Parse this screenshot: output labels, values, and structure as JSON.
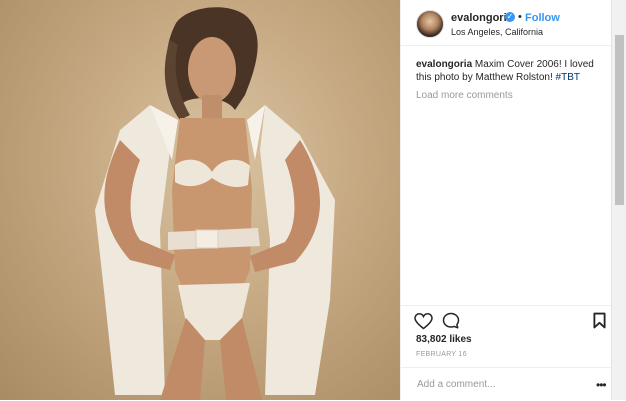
{
  "post": {
    "username": "evalongoria",
    "follow_label": "Follow",
    "separator": "•",
    "location": "Los Angeles, California",
    "caption_user": "evalongoria",
    "caption_text": "Maxim Cover 2006! I loved this photo by Matthew Rolston!",
    "caption_hashtag": "#TBT",
    "load_more": "Load more comments",
    "likes": "83,802 likes",
    "date": "FEBRUARY 16",
    "comment_placeholder": "Add a comment...",
    "more_label": "•••"
  },
  "icons": {
    "verified": "verified-badge-icon",
    "like": "heart-icon",
    "comment": "comment-bubble-icon",
    "save": "bookmark-icon",
    "more": "more-options-icon"
  },
  "colors": {
    "accent": "#3897f0",
    "photo_background": "#c6a982"
  }
}
